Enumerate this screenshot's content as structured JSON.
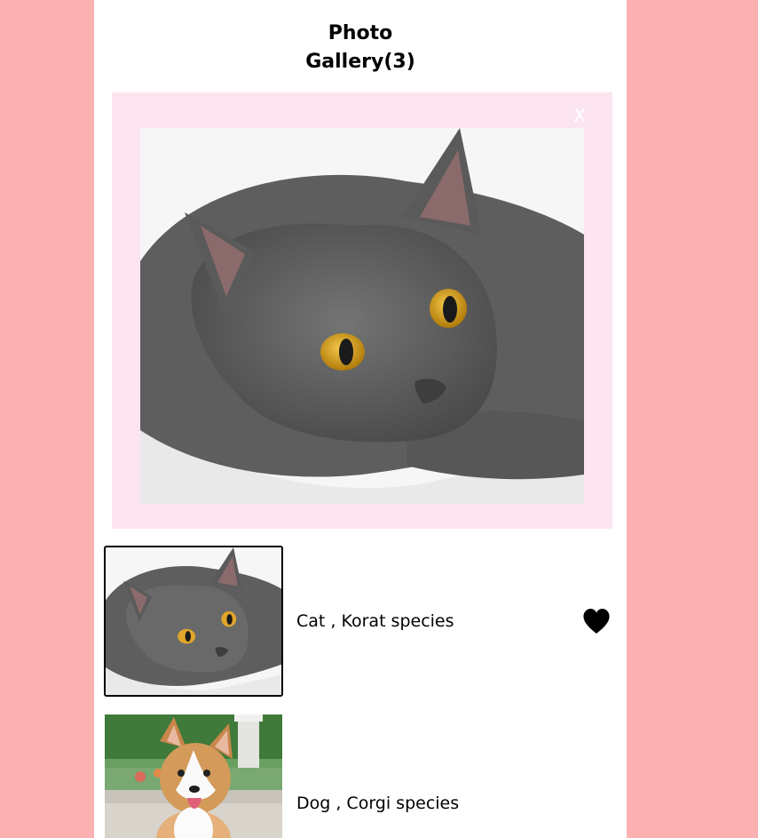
{
  "gallery": {
    "title_line1": "Photo",
    "title_line2": "Gallery(3)",
    "close_label": "X"
  },
  "photos": [
    {
      "caption": "Cat , Korat species",
      "liked": true,
      "subject": "grey cat",
      "icon": "heart-icon"
    },
    {
      "caption": "Dog , Corgi species",
      "liked": false,
      "subject": "corgi dog"
    }
  ],
  "colors": {
    "background": "#fbb1b1",
    "panel": "#ffffff",
    "viewer_background": "#fce4f0",
    "close_text": "#ffffff",
    "heart": "#000000"
  }
}
